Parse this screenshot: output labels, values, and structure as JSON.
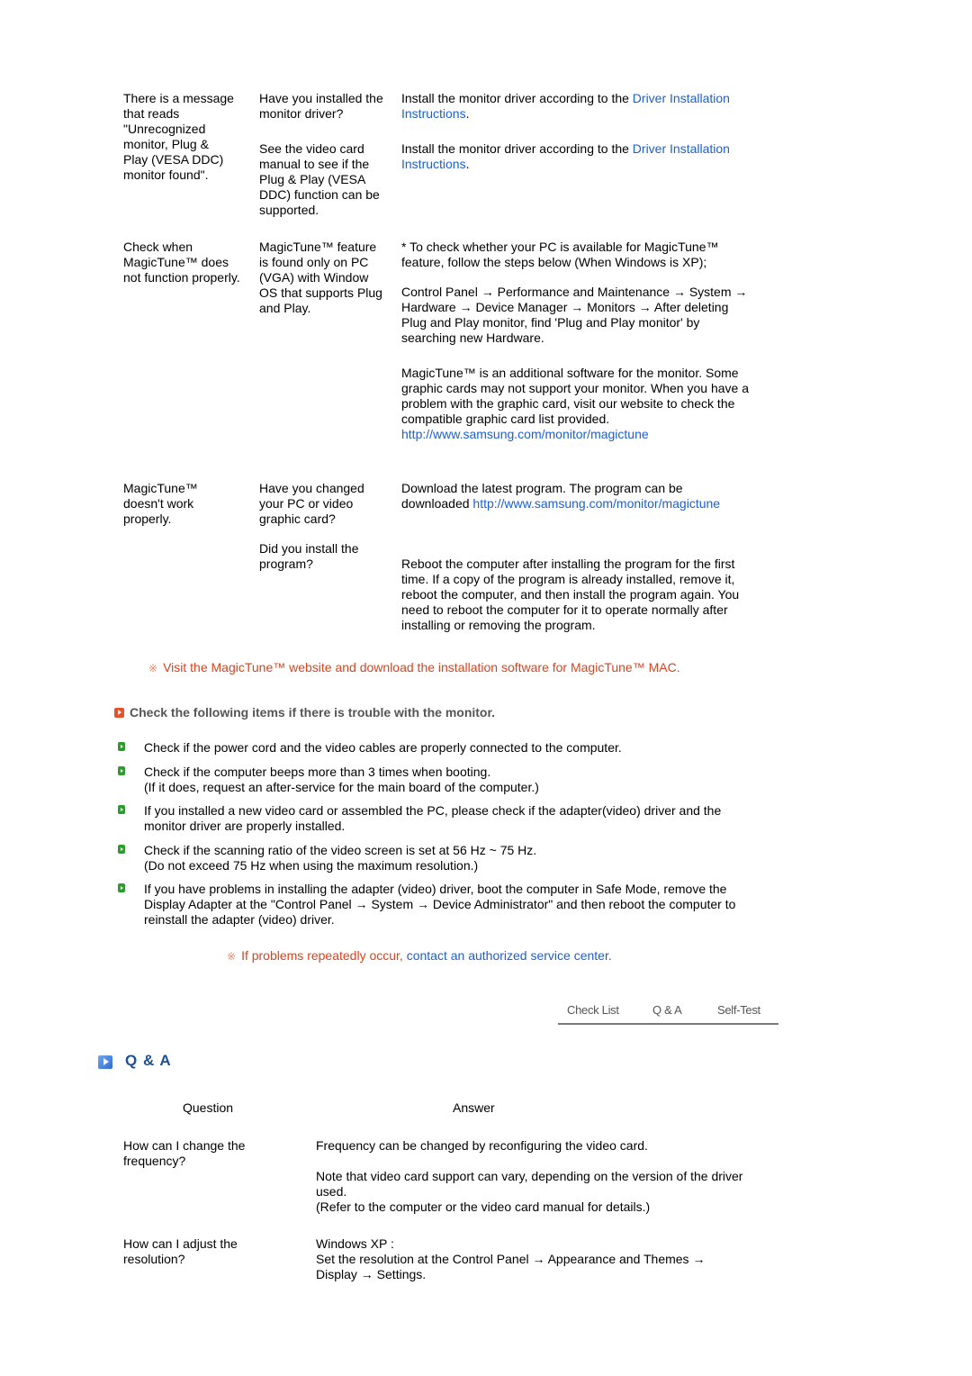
{
  "troubleshooting": {
    "rows": [
      {
        "symptom": "There is a message that reads \"Unrecognized monitor, Plug & Play (VESA DDC) monitor found\".",
        "checks": [
          {
            "check": "Have you installed the monitor driver?",
            "solution_prefix": "Install the monitor driver according to the ",
            "solution_link": "Driver Installation Instructions",
            "solution_suffix": "."
          },
          {
            "check": "See the video card manual to see if the Plug & Play (VESA DDC) function can be supported.",
            "solution_prefix": "Install the monitor driver according to the ",
            "solution_link": "Driver Installation Instructions",
            "solution_suffix": "."
          }
        ]
      },
      {
        "symptom": "Check when MagicTune™ does not function properly.",
        "check": "MagicTune™ feature is found only on PC (VGA) with Window OS that supports Plug and Play.",
        "solution_p1": "* To check whether your PC is available for MagicTune™ feature, follow the steps below (When Windows is XP);",
        "solution_p2": "Control Panel → Performance and Maintenance → System → Hardware → Device Manager → Monitors → After deleting Plug and Play monitor, find 'Plug and Play monitor' by searching new Hardware.",
        "solution_p3": "MagicTune™ is an additional software for the monitor. Some graphic cards may not support your monitor. When you have a problem with the graphic card, visit our website to check the compatible graphic card list provided.",
        "solution_link": "http://www.samsung.com/monitor/magictune"
      },
      {
        "symptom": "MagicTune™ doesn't work properly.",
        "checks": [
          {
            "check": "Have you changed your PC or video graphic card?",
            "solution_prefix": "Download the latest program. The program can be downloaded ",
            "solution_link": "http://www.samsung.com/monitor/magictune"
          },
          {
            "check": "Did you install the program?",
            "solution": "Reboot the computer after installing the program for the first time. If a copy of the program is already installed, remove it, reboot the computer, and then install the program again. You need to reboot the computer for it to operate normally after installing or removing the program."
          }
        ]
      }
    ]
  },
  "mac_note": {
    "mark": "※",
    "text": "Visit the MagicTune™ website and download the installation software for MagicTune™ MAC."
  },
  "check_section": {
    "heading": "Check the following items if there is trouble with the monitor.",
    "items": [
      {
        "line1": "Check if the power cord and the video cables are properly connected to the computer."
      },
      {
        "line1": "Check if the computer beeps more than 3 times when booting.",
        "line2": "(If it does, request an after-service for the main board of the computer.)"
      },
      {
        "line1": "If you installed a new video card or assembled the PC, please check if the adapter(video) driver and the monitor driver are properly installed."
      },
      {
        "line1": "Check if the scanning ratio of the video screen is set at 56 Hz ~ 75 Hz.",
        "line2": "(Do not exceed 75 Hz when using the maximum resolution.)"
      },
      {
        "line1": "If you have problems in installing the adapter (video) driver, boot the computer in Safe Mode, remove the Display Adapter at the \"Control Panel → System → Device Administrator\" and then reboot the computer to reinstall the adapter (video) driver."
      }
    ]
  },
  "service_note": {
    "mark": "※",
    "text": "If problems repeatedly occur, ",
    "link": "contact an authorized service center."
  },
  "tabs": [
    "Check List",
    "Q & A",
    "Self-Test"
  ],
  "qa": {
    "title": "Q & A",
    "header_question": "Question",
    "header_answer": "Answer",
    "rows": [
      {
        "question": "How can I change the frequency?",
        "answer_p1": "Frequency can be changed by reconfiguring the video card.",
        "answer_p2": "Note that video card support can vary, depending on the version of the driver used.",
        "answer_p3": "(Refer to the computer or the video card manual for details.)"
      },
      {
        "question": "How can I adjust the resolution?",
        "answer_p1": "Windows XP :",
        "answer_p2": "Set the resolution at the Control Panel → Appearance and Themes → Display → Settings."
      }
    ]
  },
  "colors": {
    "link": "#1a5fd6",
    "note_orange": "#d9431e",
    "section_icon_orange": "#e8502a",
    "bullet_green": "#2a9d2a",
    "qa_title_blue": "#1d4f93"
  }
}
